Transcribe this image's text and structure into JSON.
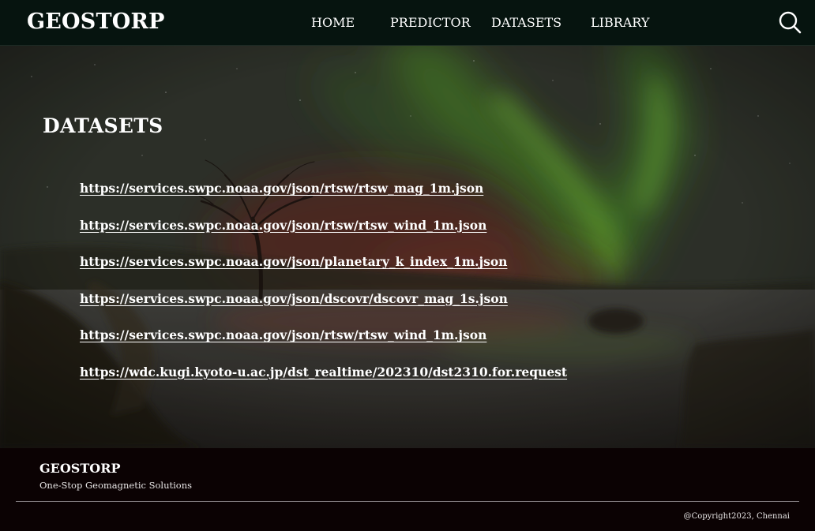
{
  "navbar": {
    "brand": "GEOSTORP",
    "links": [
      {
        "label": "HOME"
      },
      {
        "label": "PREDICTOR"
      },
      {
        "label": "DATASETS"
      },
      {
        "label": "LIBRARY"
      }
    ],
    "search_icon": "search-icon"
  },
  "main": {
    "title": "DATASETS",
    "datasets": [
      {
        "url": "https://services.swpc.noaa.gov/json/rtsw/rtsw_mag_1m.json"
      },
      {
        "url": "https://services.swpc.noaa.gov/json/rtsw/rtsw_wind_1m.json"
      },
      {
        "url": "https://services.swpc.noaa.gov/json/planetary_k_index_1m.json"
      },
      {
        "url": "https://services.swpc.noaa.gov/json/dscovr/dscovr_mag_1s.json"
      },
      {
        "url": "https://services.swpc.noaa.gov/json/rtsw/rtsw_wind_1m.json"
      },
      {
        "url": "https://wdc.kugi.kyoto-u.ac.jp/dst_realtime/202310/dst2310.for.request"
      }
    ]
  },
  "footer": {
    "brand": "GEOSTORP",
    "tagline": "One-Stop Geomagnetic Solutions",
    "copyright": "@Copyright2023, Chennai"
  },
  "colors": {
    "navbar_bg": "#06140f",
    "footer_bg": "#0b0203",
    "text": "#ffffff",
    "aurora_green": "#5fae2c",
    "aurora_red": "#7a2a22"
  }
}
